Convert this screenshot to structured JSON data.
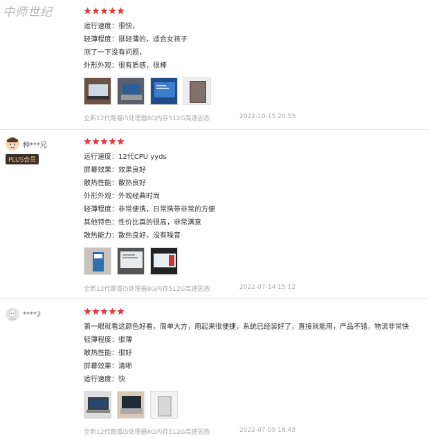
{
  "watermark": "中师世纪",
  "reviews": [
    {
      "username": "",
      "lines": [
        "运行速度：很快，",
        "轻薄程度：挺轻薄的，适合女孩子",
        "测了一下没有问题，",
        "外形外观：很有质感，很棒"
      ],
      "product": "全新12代酷睿i5处理器8G内存512G高速固态",
      "date": "2022-10-15 20:53"
    },
    {
      "username": "种***兄",
      "badge": "PLUS会员",
      "lines": [
        "运行速度：12代CPU yyds",
        "屏幕效果：效果良好",
        "散热性能：散热良好",
        "外形外观：外观经典时尚",
        "轻薄程度：非常便携，日常携带非常的方便",
        "其他特色：性价比真的很高，非常满意",
        "散热能力：散热良好，没有噪音"
      ],
      "product": "全新12代酷睿i5处理器8G内存512G高速固态",
      "date": "2022-07-14 15:12"
    },
    {
      "username": "****2",
      "lines": [
        "第一眼就看这颜色好看，简单大方，用起来很便捷，系统已经装好了，直接就能用，产品不错，物流非常快",
        "轻薄程度：很薄",
        "散热性能：很好",
        "屏幕效果：清晰",
        "运行速度：快"
      ],
      "product": "全新12代酷睿i5处理器8G内存512G高速固态",
      "date": "2022-07-09 18:43"
    }
  ],
  "colors": {
    "star": "#e4393c",
    "badge_bg": "#3b2f26",
    "badge_text": "#f1d28c"
  },
  "icons": {
    "star": "star-icon"
  }
}
